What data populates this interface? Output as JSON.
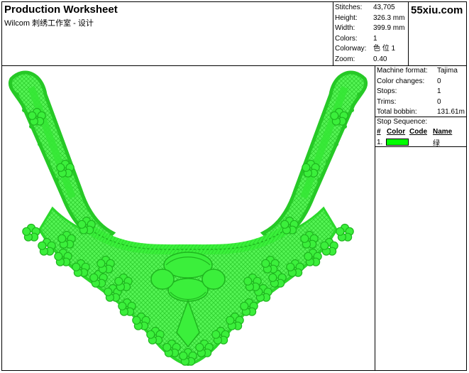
{
  "header": {
    "title": "Production Worksheet",
    "subtitle": "Wilcom 刺绣工作室 - 设计",
    "logo_text": "55xiu.com"
  },
  "design_stats": [
    {
      "label": "Stitches:",
      "value": "43,705"
    },
    {
      "label": "Height:",
      "value": "326.3 mm"
    },
    {
      "label": "Width:",
      "value": "399.9 mm"
    },
    {
      "label": "Colors:",
      "value": "1"
    },
    {
      "label": "Colorway:",
      "value": "色 位 1"
    },
    {
      "label": "Zoom:",
      "value": "0.40"
    }
  ],
  "machine_stats": [
    {
      "label": "Machine format:",
      "value": "Tajima"
    },
    {
      "label": "Color changes:",
      "value": "0"
    },
    {
      "label": "Stops:",
      "value": "1"
    },
    {
      "label": "Trims:",
      "value": "0"
    },
    {
      "label": "Total bobbin:",
      "value": "131.61m"
    }
  ],
  "stop_sequence": {
    "title": "Stop Sequence:",
    "headers": {
      "num": "#",
      "color": "Color",
      "code": "Code",
      "name": "Name"
    },
    "rows": [
      {
        "num": "1.",
        "color": "#00ff00",
        "code": "",
        "name": "绿"
      }
    ]
  },
  "colors": {
    "thread": "#33ee33",
    "thread_dark": "#22bb22",
    "swatch": "#00ff00"
  },
  "icons": {
    "design_preview": "embroidered-lace-collar"
  }
}
